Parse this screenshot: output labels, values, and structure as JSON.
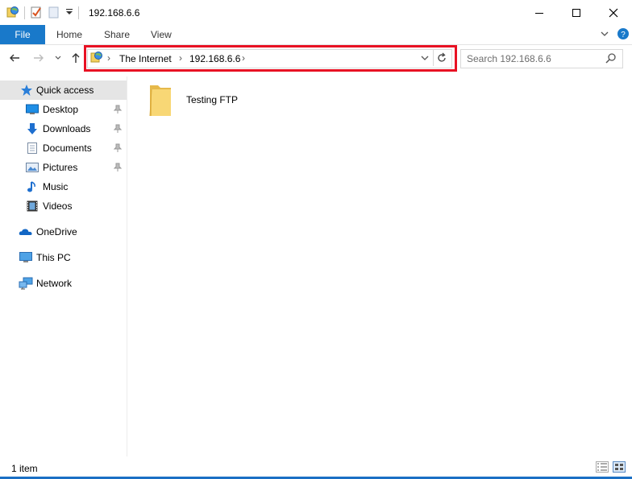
{
  "window": {
    "title": "192.168.6.6",
    "minimize_glyph": "—",
    "maximize_glyph": "☐",
    "close_glyph": "✕"
  },
  "ribbon": {
    "tabs": [
      {
        "label": "File"
      },
      {
        "label": "Home"
      },
      {
        "label": "Share"
      },
      {
        "label": "View"
      }
    ]
  },
  "address_bar": {
    "breadcrumbs": [
      "The Internet",
      "192.168.6.6"
    ]
  },
  "search": {
    "placeholder": "Search 192.168.6.6"
  },
  "nav_pane": {
    "quick_access": "Quick access",
    "quick_items": [
      {
        "label": "Desktop",
        "icon": "desktop-icon"
      },
      {
        "label": "Downloads",
        "icon": "downloads-icon"
      },
      {
        "label": "Documents",
        "icon": "documents-icon"
      },
      {
        "label": "Pictures",
        "icon": "pictures-icon"
      },
      {
        "label": "Music",
        "icon": "music-icon"
      },
      {
        "label": "Videos",
        "icon": "videos-icon"
      }
    ],
    "onedrive": "OneDrive",
    "this_pc": "This PC",
    "network": "Network"
  },
  "content": {
    "items": [
      {
        "label": "Testing FTP",
        "icon": "folder-icon"
      }
    ]
  },
  "status_bar": {
    "item_count": "1 item"
  },
  "colors": {
    "accent": "#1979ca",
    "highlight_border": "#e81123",
    "folder": "#f5d775"
  }
}
